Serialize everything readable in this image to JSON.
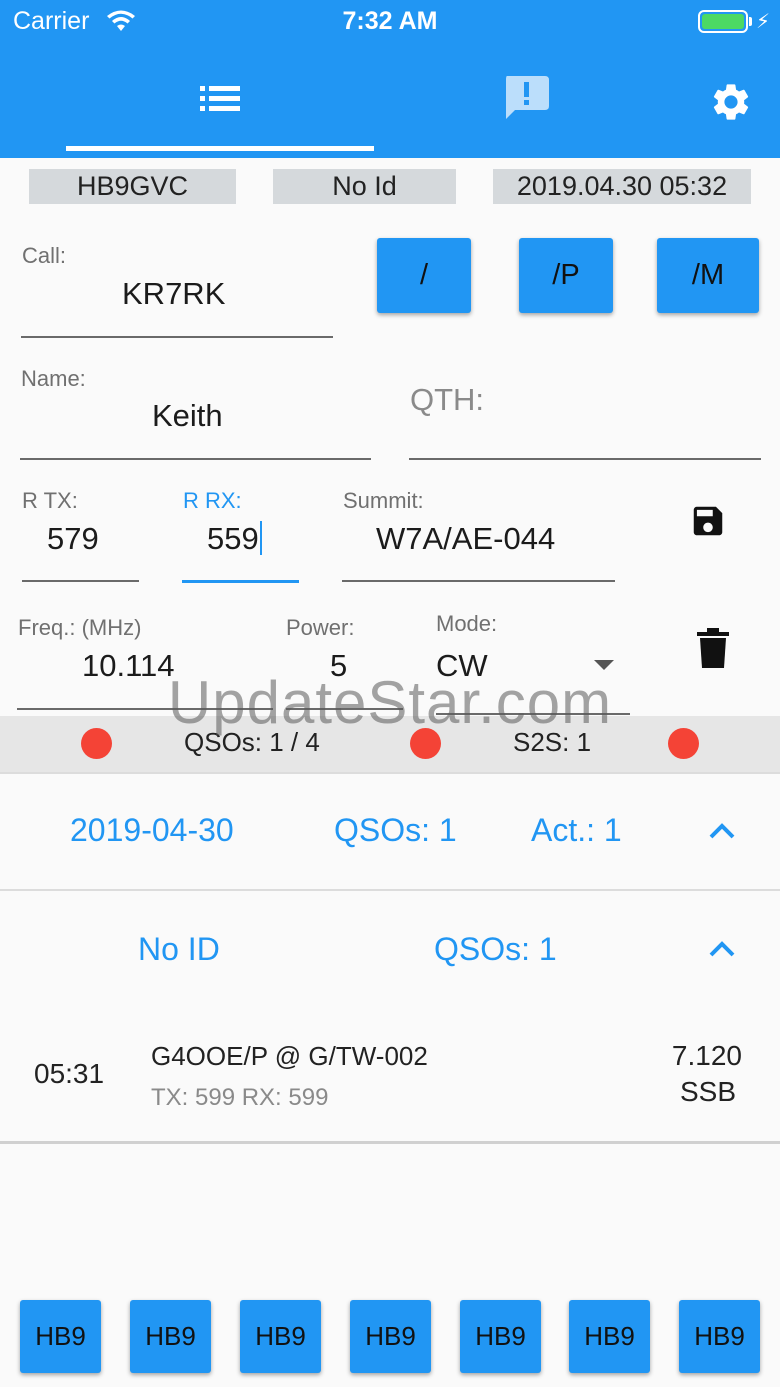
{
  "status_bar": {
    "carrier": "Carrier",
    "time": "7:32 AM"
  },
  "info": {
    "operator": "HB9GVC",
    "id": "No Id",
    "datetime": "2019.04.30 05:32"
  },
  "form": {
    "call_label": "Call:",
    "call_value": "KR7RK",
    "suffix_buttons": [
      "/",
      "/P",
      "/M"
    ],
    "name_label": "Name:",
    "name_value": "Keith",
    "qth_placeholder": "QTH:",
    "rtx_label": "R TX:",
    "rtx_value": "579",
    "rrx_label": "R RX:",
    "rrx_value": "559",
    "summit_label": "Summit:",
    "summit_value": "W7A/AE-044",
    "freq_label": "Freq.: (MHz)",
    "freq_value": "10.114",
    "power_label": "Power:",
    "power_value": "5",
    "mode_label": "Mode:",
    "mode_value": "CW"
  },
  "stats": {
    "qsos": "QSOs: 1 / 4",
    "s2s": "S2S: 1"
  },
  "day_group": {
    "date": "2019-04-30",
    "qsos": "QSOs: 1",
    "act": "Act.: 1"
  },
  "id_group": {
    "id": "No ID",
    "qsos": "QSOs: 1"
  },
  "log_entry": {
    "time": "05:31",
    "title": "G4OOE/P @ G/TW-002",
    "reports": "TX: 599 RX: 599",
    "freq": "7.120",
    "mode": "SSB"
  },
  "quick_buttons": [
    "HB9",
    "HB9",
    "HB9",
    "HB9",
    "HB9",
    "HB9",
    "HB9"
  ],
  "watermark": "UpdateStar.com",
  "colors": {
    "primary": "#2196f3",
    "accent_dot": "#f44336",
    "info_bg": "#d5d9dc"
  }
}
